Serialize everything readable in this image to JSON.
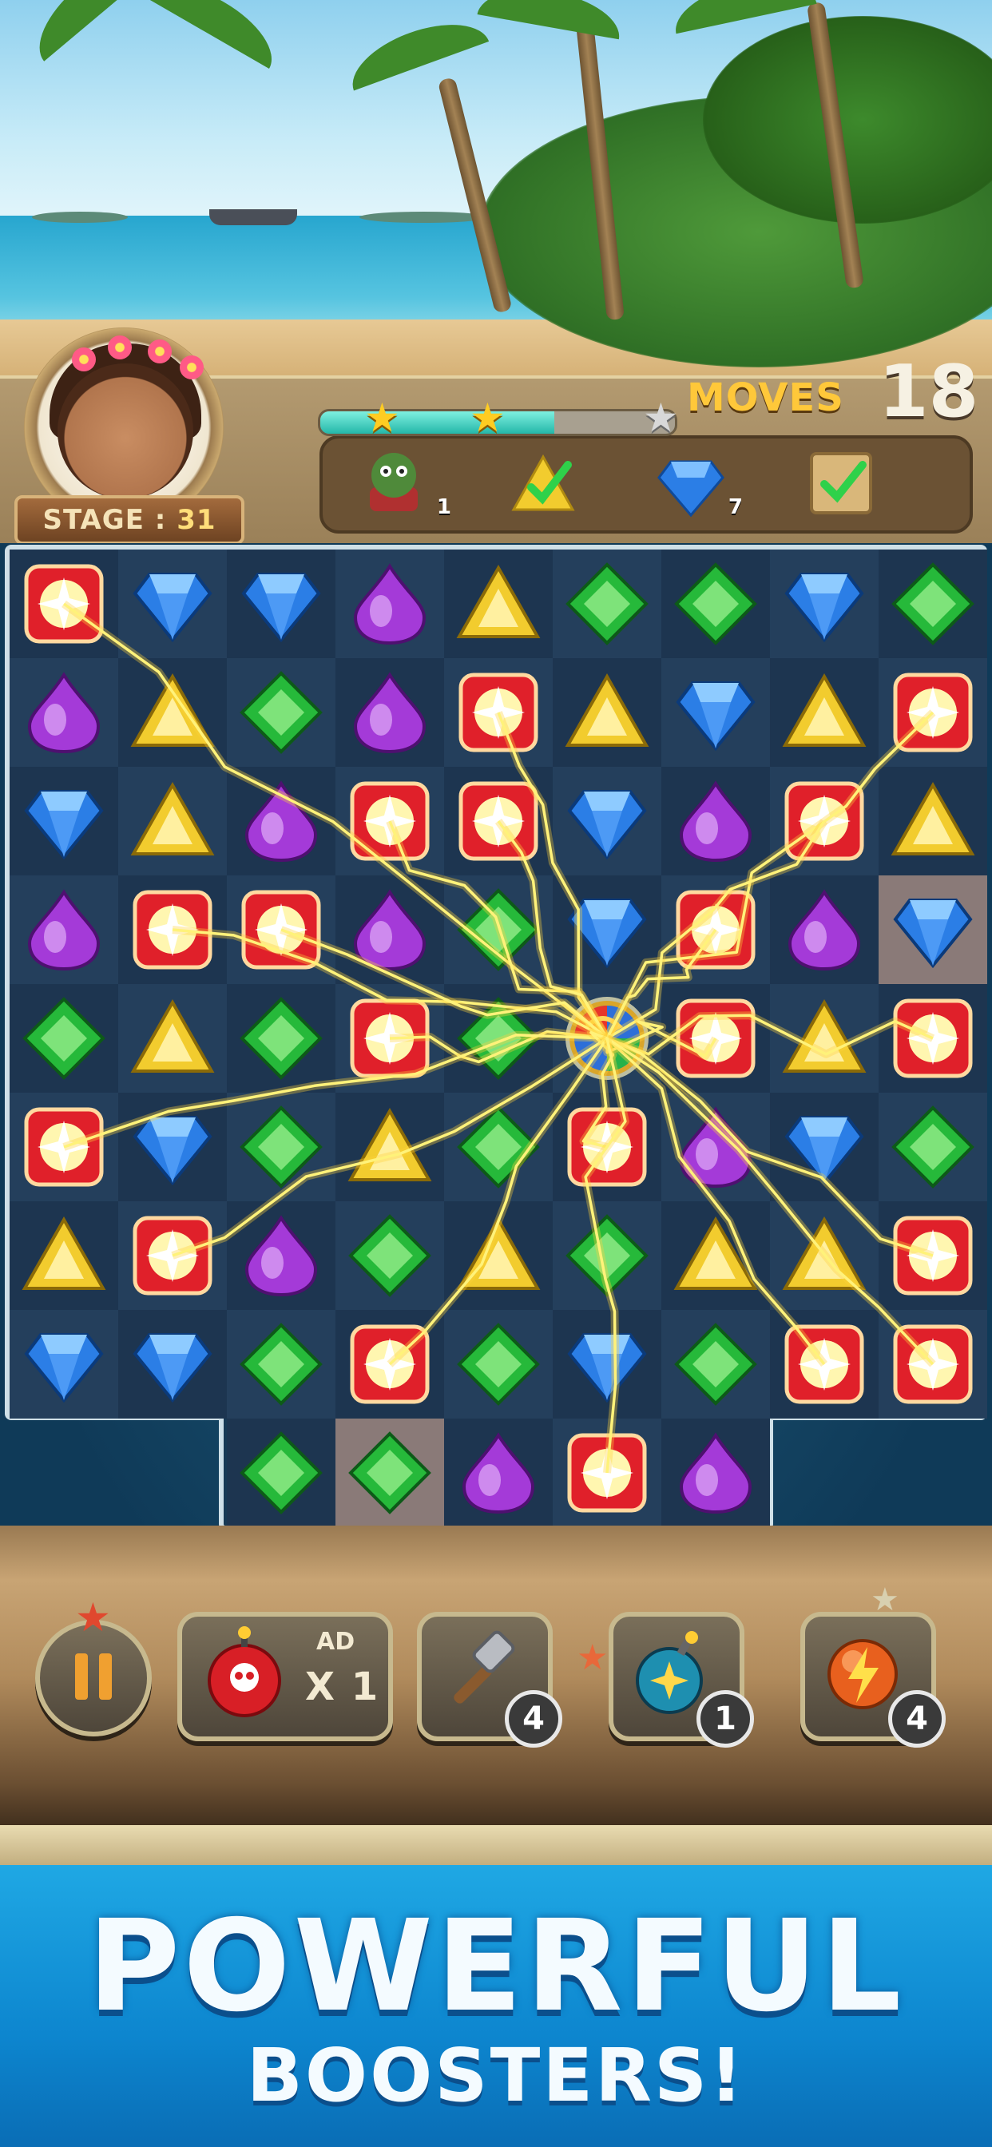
{
  "hud": {
    "stage_label": "STAGE :",
    "stage_number": "31",
    "moves_label": "MOVES",
    "moves_value": "18",
    "progress": 0.66,
    "stars_earned": 2,
    "stars_total": 3
  },
  "goals": [
    {
      "icon": "totem-icon",
      "count": "1",
      "done": false
    },
    {
      "icon": "yellow-triangle-gem-icon",
      "count": "",
      "done": true
    },
    {
      "icon": "blue-diamond-gem-icon",
      "count": "7",
      "done": false
    },
    {
      "icon": "crate-icon",
      "count": "",
      "done": true
    }
  ],
  "board": {
    "rows": [
      [
        "red",
        "blue",
        "blue",
        "purple",
        "yellow",
        "green",
        "green",
        "blue",
        "green"
      ],
      [
        "purple",
        "yellow",
        "green",
        "purple",
        "red",
        "yellow",
        "blue",
        "yellow",
        "red"
      ],
      [
        "blue",
        "yellow",
        "purple",
        "red",
        "red",
        "blue",
        "purple",
        "red",
        "yellow"
      ],
      [
        "purple",
        "red",
        "red",
        "purple",
        "green",
        "blue",
        "red",
        "purple",
        "blue"
      ],
      [
        "green",
        "yellow",
        "green",
        "red",
        "green",
        "orb",
        "red",
        "yellow",
        "red"
      ],
      [
        "red",
        "blue",
        "green",
        "yellow",
        "green",
        "red",
        "purple",
        "blue",
        "green"
      ],
      [
        "yellow",
        "red",
        "purple",
        "green",
        "yellow",
        "green",
        "yellow",
        "yellow",
        "red"
      ],
      [
        "blue",
        "blue",
        "green",
        "red",
        "green",
        "blue",
        "green",
        "red",
        "red"
      ],
      [
        "",
        "",
        "green",
        "green",
        "purple",
        "red",
        "purple",
        "",
        ""
      ]
    ],
    "highlighted_cells": [
      [
        3,
        8
      ],
      [
        8,
        3
      ]
    ]
  },
  "boosters": {
    "pause_icon": "pause-icon",
    "ad_label": "AD",
    "ad_count": "X 1",
    "items": [
      {
        "icon": "hammer-icon",
        "count": "4"
      },
      {
        "icon": "bomb-icon",
        "count": "1"
      },
      {
        "icon": "lightning-orb-icon",
        "count": "4"
      }
    ]
  },
  "banner": {
    "headline": "POWERFUL",
    "subline": "BOOSTERS!"
  },
  "colors": {
    "red": "#e0202a",
    "blue": "#2b7ee6",
    "green": "#26b93a",
    "purple": "#a43ad8",
    "yellow": "#f2cc2e",
    "lightning": "#fff27a"
  }
}
